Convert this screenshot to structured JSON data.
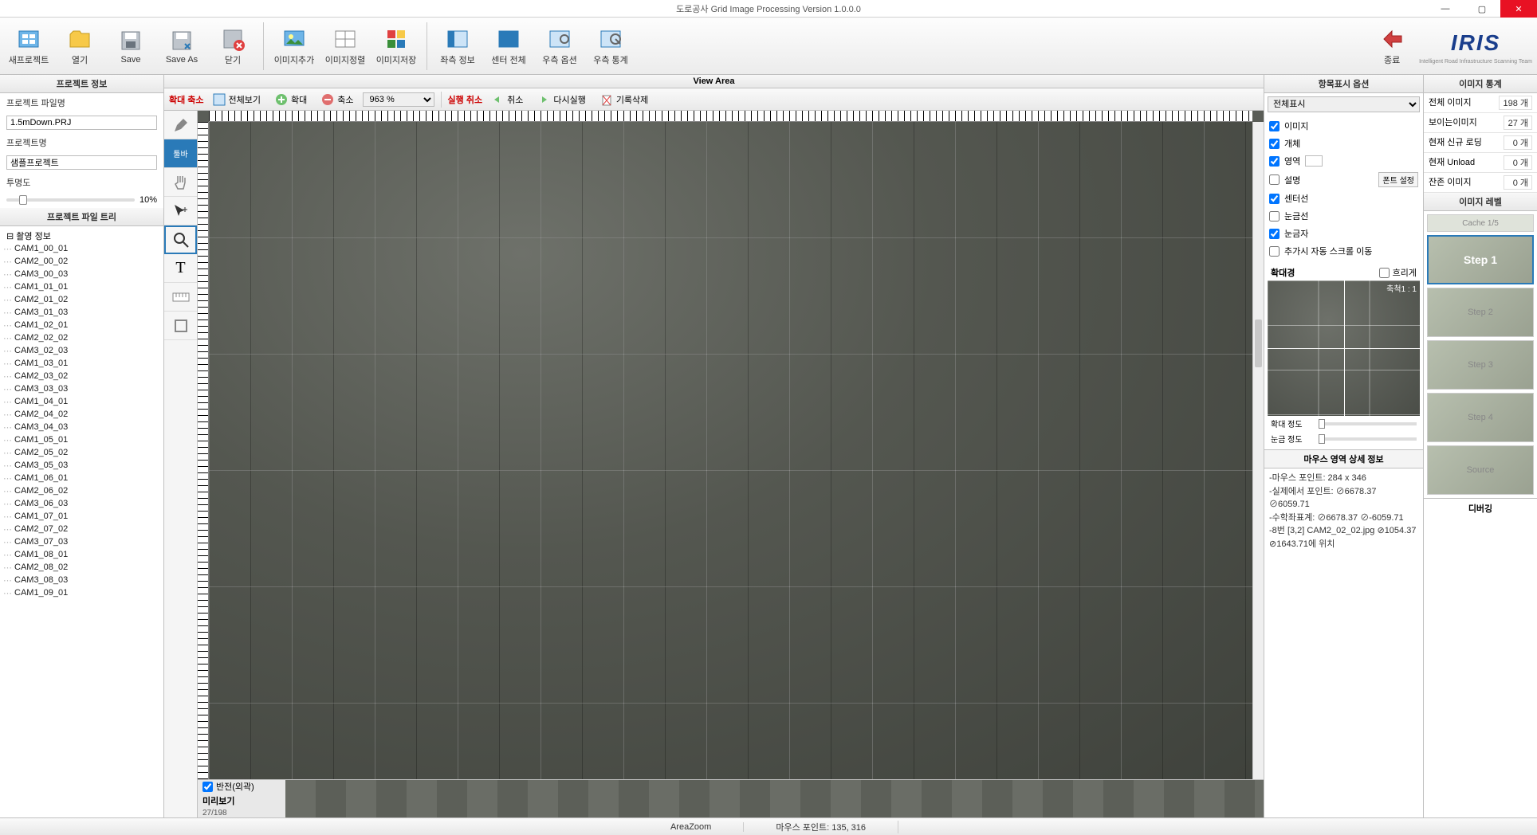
{
  "titlebar": {
    "title": "도로공사 Grid Image Processing Version 1.0.0.0"
  },
  "ribbon": {
    "new_project": "새프로젝트",
    "open": "열기",
    "save": "Save",
    "save_as": "Save As",
    "close": "닫기",
    "add_image": "이미지추가",
    "align_image": "이미지정렬",
    "save_image": "이미지저장",
    "left_info": "좌측 정보",
    "center_all": "센터 전체",
    "right_option": "우측 옵션",
    "right_stat": "우측 통계",
    "exit": "종료",
    "logo": "IRIS",
    "logo_sub": "Intelligent Road Infrastructure Scanning Team"
  },
  "left": {
    "head": "프로젝트 정보",
    "file_label": "프로젝트 파일명",
    "file_value": "1.5mDown.PRJ",
    "name_label": "프로젝트명",
    "name_value": "샘플프로젝트",
    "opacity_label": "투명도",
    "opacity_value": "10%",
    "tree_head": "프로젝트 파일 트리",
    "root": "촬영 정보",
    "nodes": [
      "CAM1_00_01",
      "CAM2_00_02",
      "CAM3_00_03",
      "CAM1_01_01",
      "CAM2_01_02",
      "CAM3_01_03",
      "CAM1_02_01",
      "CAM2_02_02",
      "CAM3_02_03",
      "CAM1_03_01",
      "CAM2_03_02",
      "CAM3_03_03",
      "CAM1_04_01",
      "CAM2_04_02",
      "CAM3_04_03",
      "CAM1_05_01",
      "CAM2_05_02",
      "CAM3_05_03",
      "CAM1_06_01",
      "CAM2_06_02",
      "CAM3_06_03",
      "CAM1_07_01",
      "CAM2_07_02",
      "CAM3_07_03",
      "CAM1_08_01",
      "CAM2_08_02",
      "CAM3_08_03",
      "CAM1_09_01"
    ]
  },
  "center": {
    "view_head": "View Area",
    "zoom_label": "확대 축소",
    "view_all": "전체보기",
    "zoom_in": "확대",
    "zoom_out": "축소",
    "zoom_value": "963 %",
    "undo_label": "실행 취소",
    "undo": "취소",
    "redo": "다시실행",
    "del_history": "기록삭제",
    "toolbar_label": "툴바",
    "preview_chk": "반전(외곽)",
    "preview_label": "미리보기",
    "preview_count": "27/198"
  },
  "right": {
    "head": "항목표시 옵션",
    "select_value": "전체표시",
    "opts": {
      "image": "이미지",
      "object": "개체",
      "area": "영역",
      "desc": "설명",
      "font_btn": "폰트 설정",
      "center": "센터선",
      "grid": "눈금선",
      "ruler": "눈금자",
      "autoscroll": "추가시 자동 스크롤 이동"
    },
    "mag_head": "확대경",
    "mag_chk": "흐리게",
    "mag_scale": "축척1 : 1",
    "mag_zoom": "확대 정도",
    "mag_grid": "눈금 정도",
    "info_head": "마우스 영역 상세 정보",
    "info_lines": [
      "-마우스 포인트: 284 x 346",
      "-실제에서 포인트: ⊘6678.37 ⊘6059.71",
      "-수학좌표계: ⊘6678.37 ⊘-6059.71",
      "-8번 [3,2] CAM2_02_02.jpg ⊘1054.37 ⊘1643.71에 위치"
    ]
  },
  "far": {
    "head": "이미지 통계",
    "stats": [
      {
        "k": "전체 이미지",
        "v": "198",
        "u": "개"
      },
      {
        "k": "보이는이미지",
        "v": "27",
        "u": "개"
      },
      {
        "k": "현재 신규 로딩",
        "v": "0",
        "u": "개"
      },
      {
        "k": "현재 Unload",
        "v": "0",
        "u": "개"
      },
      {
        "k": "잔존 이미지",
        "v": "0",
        "u": "개"
      }
    ],
    "level_head": "이미지 레벨",
    "cache": "Cache 1/5",
    "levels": [
      "Step 1",
      "Step 2",
      "Step 3",
      "Step 4",
      "Source"
    ],
    "debug": "디버깅"
  },
  "status": {
    "mode": "AreaZoom",
    "mouse": "마우스 포인트: 135, 316"
  }
}
